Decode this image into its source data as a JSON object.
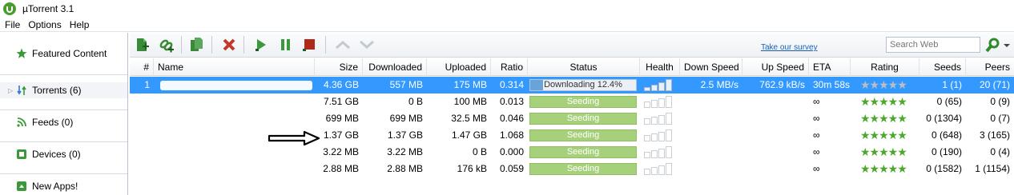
{
  "window": {
    "title": "µTorrent 3.1"
  },
  "menu": {
    "items": [
      "File",
      "Options",
      "Help"
    ]
  },
  "sidebar": {
    "items": [
      {
        "label": "Featured Content",
        "icon": "star-icon"
      },
      {
        "label": "Torrents (6)",
        "icon": "torrents-icon"
      },
      {
        "label": "Feeds (0)",
        "icon": "rss-icon"
      },
      {
        "label": "Devices (0)",
        "icon": "device-icon"
      },
      {
        "label": "New Apps!",
        "icon": "apps-icon"
      }
    ]
  },
  "toolbar": {
    "survey_link": "Take our survey",
    "search_placeholder": "Search Web"
  },
  "table": {
    "headers": [
      "#",
      "Name",
      "Size",
      "Downloaded",
      "Uploaded",
      "Ratio",
      "Status",
      "Health",
      "Down Speed",
      "Up Speed",
      "ETA",
      "Rating",
      "Seeds",
      "Peers"
    ],
    "rows": [
      {
        "num": "1",
        "size": "4.36 GB",
        "downloaded": "557 MB",
        "uploaded": "175 MB",
        "ratio": "0.314",
        "status": "Downloading 12.4%",
        "progress": 0.124,
        "down_speed": "2.5 MB/s",
        "up_speed": "762.9 kB/s",
        "eta": "30m 58s",
        "seeds": "1 (1)",
        "peers": "20 (71)"
      },
      {
        "num": "",
        "size": "7.51 GB",
        "downloaded": "0 B",
        "uploaded": "100 MB",
        "ratio": "0.013",
        "status": "Seeding",
        "down_speed": "",
        "up_speed": "",
        "eta": "∞",
        "seeds": "0 (65)",
        "peers": "0 (9)"
      },
      {
        "num": "",
        "size": "699 MB",
        "downloaded": "699 MB",
        "uploaded": "32.5 MB",
        "ratio": "0.046",
        "status": "Seeding",
        "down_speed": "",
        "up_speed": "",
        "eta": "∞",
        "seeds": "0 (1304)",
        "peers": "0 (7)"
      },
      {
        "num": "",
        "size": "1.37 GB",
        "downloaded": "1.37 GB",
        "uploaded": "1.47 GB",
        "ratio": "1.068",
        "status": "Seeding",
        "down_speed": "",
        "up_speed": "",
        "eta": "∞",
        "seeds": "0 (648)",
        "peers": "3 (165)"
      },
      {
        "num": "",
        "size": "3.22 MB",
        "downloaded": "3.22 MB",
        "uploaded": "0 B",
        "ratio": "0.000",
        "status": "Seeding",
        "down_speed": "",
        "up_speed": "",
        "eta": "∞",
        "seeds": "0 (190)",
        "peers": "0 (4)"
      },
      {
        "num": "",
        "size": "2.88 MB",
        "downloaded": "2.88 MB",
        "uploaded": "176 kB",
        "ratio": "0.059",
        "status": "Seeding",
        "down_speed": "",
        "up_speed": "",
        "eta": "∞",
        "seeds": "0 (1582)",
        "peers": "1 (1154)"
      }
    ]
  },
  "colors": {
    "selection": "#3399ff",
    "seeding": "#a6d07a",
    "star_green": "#4ca82c"
  }
}
